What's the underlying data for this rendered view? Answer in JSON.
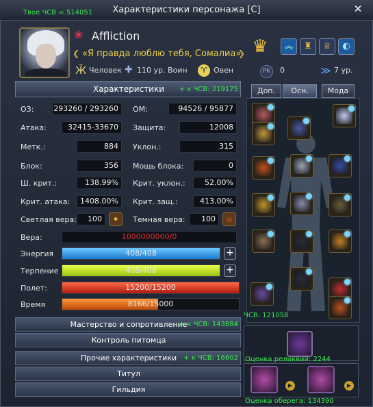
{
  "window": {
    "title": "Характеристики персонажа [C]",
    "close": "✕"
  },
  "gs_top": "Твое ЧСВ = 514051",
  "character": {
    "name": "Affliction",
    "motto": "«Я правда люблю тебя, Сомалиа»",
    "race": "Человек",
    "level_class": "110 ур. Воин",
    "zodiac": "Овен",
    "pk": "0",
    "rank": "7 ур."
  },
  "stats_header": {
    "label": "Характеристики",
    "bonus": "+ к ЧСВ: 219175"
  },
  "stats": {
    "hp_label": "ОЗ:",
    "hp": "293260 / 293260",
    "mp_label": "ОМ:",
    "mp": "94526 / 95877",
    "atk_label": "Атака:",
    "atk": "32415-33670",
    "def_label": "Защита:",
    "def": "12008",
    "acc_label": "Метк.:",
    "acc": "884",
    "eva_label": "Уклон.:",
    "eva": "315",
    "block_label": "Блок:",
    "block": "356",
    "bpow_label": "Мощь блока:",
    "bpow": "0",
    "crit_label": "Ш. крит.:",
    "crit": "138.99%",
    "crev_label": "Крит. уклон.:",
    "crev": "52.00%",
    "cratk_label": "Крит. атака:",
    "cratk": "1408.00%",
    "crdef_label": "Крит. защ.:",
    "crdef": "413.00%",
    "light_label": "Светлая вера:",
    "light": "100",
    "dark_label": "Темная вера:",
    "dark": "100",
    "faith_label": "Вера:",
    "faith": "1000000000/0"
  },
  "bars": {
    "energy_label": "Энергия",
    "energy": "408/408",
    "energy_fill": 1.0,
    "patience_label": "Терпение",
    "patience": "408/408",
    "patience_fill": 1.0,
    "flight_label": "Полет:",
    "flight": "15200/15200",
    "flight_fill": 1.0,
    "time_label": "Время",
    "time": "8166/15000",
    "time_fill": 0.544
  },
  "sections": {
    "mastery": "Мастерство и сопротивление",
    "mastery_bonus": "+ к ЧСВ: 143884",
    "pet": "Контроль питомца",
    "other": "Прочие характеристики",
    "other_bonus": "+ к ЧСВ: 16602",
    "titul": "Титул",
    "guild": "Гильдия"
  },
  "tabs": {
    "extra": "Доп.",
    "main": "Осн.",
    "fashion": "Мода"
  },
  "equipment": {
    "gs": "ЧСВ: 121058",
    "reliq_gs": "Оценка реликвий: 2244",
    "amulet_gs": "Оценка оберега: 134390"
  },
  "colors": {
    "bonus_green": "#3bea4f",
    "motto_gold": "#f0d24a",
    "faith_red": "#e03030"
  }
}
